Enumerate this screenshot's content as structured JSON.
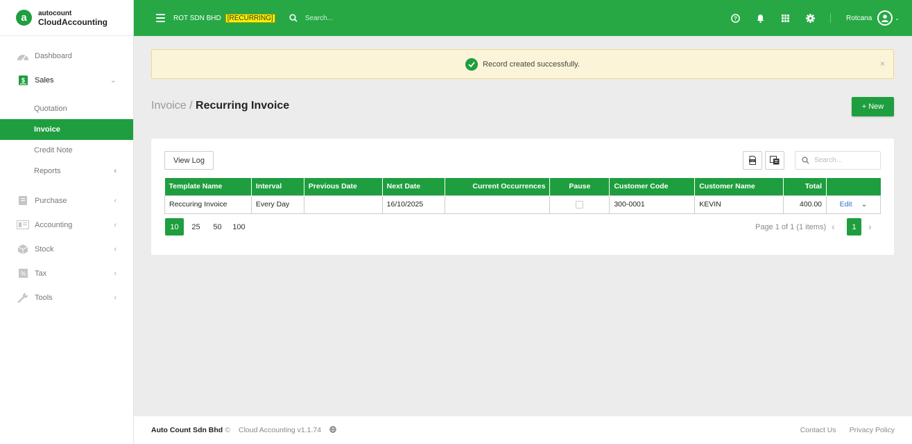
{
  "brand": {
    "logo_letter": "a",
    "line1": "autocount",
    "line2": "CloudAccounting",
    "color": "#1e9e3e"
  },
  "sidebar": {
    "items": [
      {
        "label": "Dashboard",
        "icon": "dashboard-icon"
      },
      {
        "label": "Sales",
        "icon": "sales-icon",
        "open": true,
        "children": [
          {
            "label": "Quotation"
          },
          {
            "label": "Invoice",
            "active": true
          },
          {
            "label": "Credit Note"
          },
          {
            "label": "Reports"
          }
        ]
      },
      {
        "label": "Purchase",
        "icon": "purchase-icon"
      },
      {
        "label": "Accounting",
        "icon": "accounting-icon"
      },
      {
        "label": "Stock",
        "icon": "stock-icon"
      },
      {
        "label": "Tax",
        "icon": "tax-icon"
      },
      {
        "label": "Tools",
        "icon": "tools-icon"
      }
    ]
  },
  "header": {
    "company": "ROT SDN BHD",
    "tag": "[RECURRING]",
    "search_placeholder": "Search...",
    "user": "Rotcana",
    "icons": [
      "help-icon",
      "bell-icon",
      "apps-grid-icon",
      "gear-icon"
    ]
  },
  "alert": {
    "message": "Record created successfully.",
    "close": "×"
  },
  "page": {
    "crumb": "Invoice / ",
    "title": "Recurring Invoice",
    "new_button": "+ New"
  },
  "toolbar": {
    "view_log": "View Log",
    "search_placeholder": "Search..."
  },
  "table": {
    "columns": [
      "Template Name",
      "Interval",
      "Previous Date",
      "Next Date",
      "Current Occurrences",
      "Pause",
      "Customer Code",
      "Customer Name",
      "Total",
      ""
    ],
    "rows": [
      {
        "template_name": "Reccuring Invoice",
        "interval": "Every Day",
        "previous_date": "",
        "next_date": "16/10/2025",
        "current_occurrences": "",
        "pause": false,
        "customer_code": "300-0001",
        "customer_name": "KEVIN",
        "total": "400.00",
        "action": "Edit"
      }
    ]
  },
  "pager": {
    "sizes": [
      "10",
      "25",
      "50",
      "100"
    ],
    "selected_size": "10",
    "info": "Page 1 of 1 (1 items)",
    "current_page": "1"
  },
  "footer": {
    "company": "Auto Count Sdn Bhd",
    "copyright": "©",
    "version": "Cloud Accounting v1.1.74",
    "links": [
      "Contact Us",
      "Privacy Policy"
    ]
  }
}
